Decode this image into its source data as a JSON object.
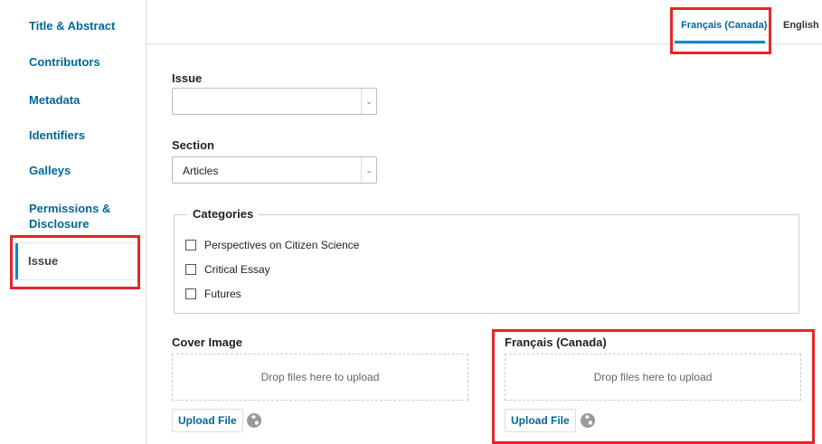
{
  "sidebar": {
    "items": [
      {
        "label": "Title & Abstract"
      },
      {
        "label": "Contributors"
      },
      {
        "label": "Metadata"
      },
      {
        "label": "Identifiers"
      },
      {
        "label": "Galleys"
      },
      {
        "label": "Permissions &"
      },
      {
        "label": "Disclosure"
      }
    ],
    "active_label": "Issue"
  },
  "languages": {
    "active": "Français (Canada)",
    "other": "English"
  },
  "form": {
    "issue_label": "Issue",
    "issue_value": "",
    "section_label": "Section",
    "section_value": "Articles",
    "categories_legend": "Categories",
    "categories": [
      {
        "label": "Perspectives on Citizen Science",
        "checked": false
      },
      {
        "label": "Critical Essay",
        "checked": false
      },
      {
        "label": "Futures",
        "checked": false
      }
    ],
    "cover_image_label": "Cover Image",
    "cover_image_locale_label": "Français (Canada)",
    "drop_text": "Drop files here to upload",
    "upload_label": "Upload File"
  },
  "colors": {
    "accent": "#006798",
    "highlight": "#e5262b"
  }
}
